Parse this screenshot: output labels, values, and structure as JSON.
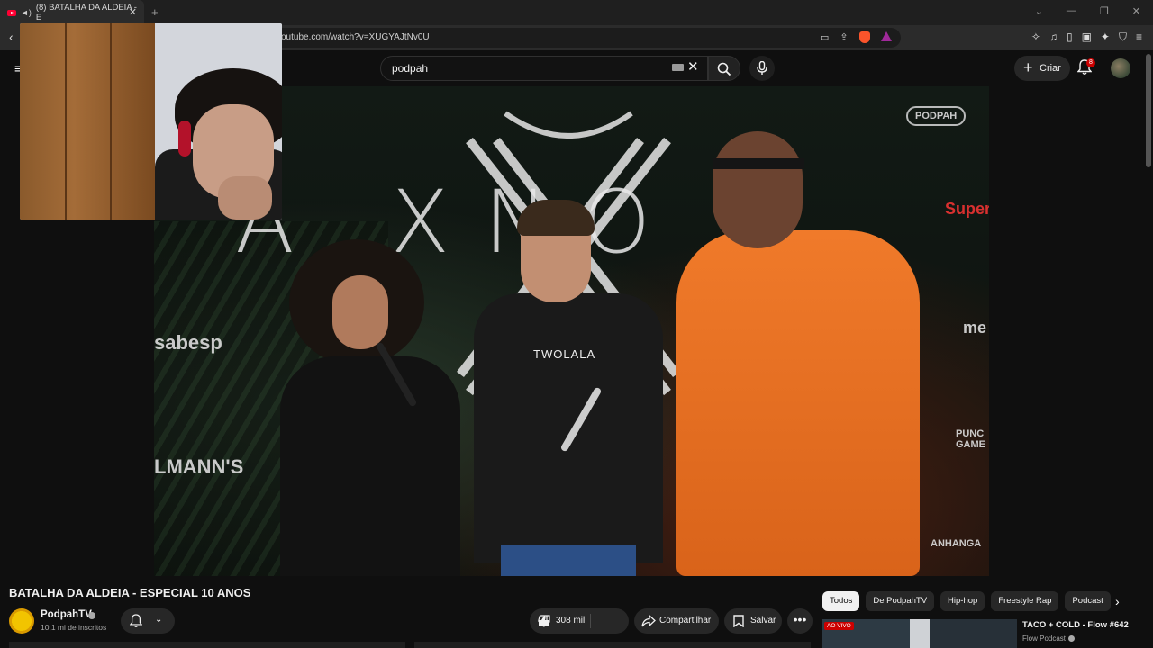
{
  "browser": {
    "tab_title": "(8) BATALHA DA ALDEIA - E",
    "url": "outube.com/watch?v=XUGYAJtNv0U"
  },
  "youtube": {
    "search_value": "podpah",
    "create_label": "Criar",
    "notification_count": "8"
  },
  "video": {
    "title": "BATALHA DA ALDEIA - ESPECIAL 10 ANOS",
    "scene_text": {
      "brand": "Α ΧΝΟ",
      "sabesp": "sabesp",
      "podpah": "PODPAH",
      "lmanns": "LMANN'S",
      "super": "Super",
      "punch": "PUNC GAME",
      "anhanga": "ANHANGA",
      "me": "me",
      "twolala": "TWOLALA"
    }
  },
  "channel": {
    "name": "PodpahTV",
    "subscribers": "10,1 mi de inscritos"
  },
  "actions": {
    "likes": "308 mil",
    "share_label": "Compartilhar",
    "save_label": "Salvar"
  },
  "chips": [
    "Todos",
    "De PodpahTV",
    "Hip-hop",
    "Freestyle Rap",
    "Podcast"
  ],
  "recommendation": {
    "title": "TACO + COLD - Flow #642",
    "channel": "Flow Podcast",
    "live_badge": "AO VIVO"
  },
  "colors": {
    "accent_red": "#ff0033",
    "shirt_orange": "#f07a2a"
  }
}
